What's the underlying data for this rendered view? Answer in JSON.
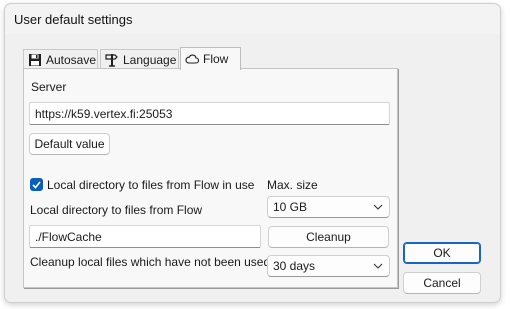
{
  "window": {
    "title": "User default settings"
  },
  "tabs": [
    {
      "label": "Autosave",
      "icon": "floppy-disk-icon",
      "active": false
    },
    {
      "label": "Language",
      "icon": "sign-post-icon",
      "active": false
    },
    {
      "label": "Flow",
      "icon": "cloud-icon",
      "active": true
    }
  ],
  "server": {
    "label": "Server",
    "value": "https://k59.vertex.fi:25053",
    "default_button": "Default value"
  },
  "local_dir": {
    "checkbox_label": "Local directory to files from Flow in use",
    "checked": true,
    "dir_label": "Local directory to files from Flow",
    "dir_value": "./FlowCache",
    "max_size_label": "Max. size",
    "max_size_value": "10 GB",
    "cleanup_button": "Cleanup",
    "cleanup_label": "Cleanup local files which have not been used for",
    "cleanup_value": "30 days"
  },
  "dialog": {
    "ok": "OK",
    "cancel": "Cancel"
  },
  "colors": {
    "accent": "#0a5fb8",
    "primary_border": "#1b64c4"
  }
}
